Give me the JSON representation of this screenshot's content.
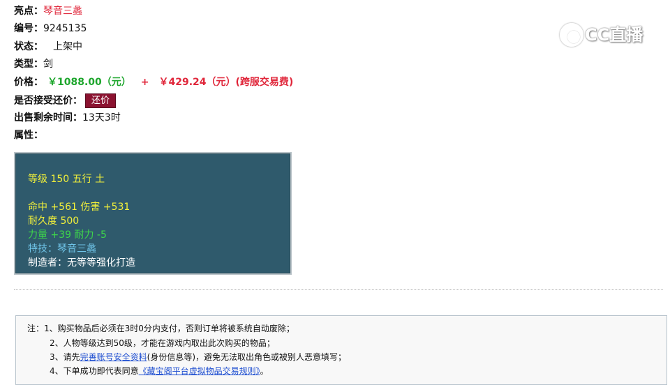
{
  "fields": {
    "highlight": {
      "label": "亮点：",
      "value": "琴音三蠡"
    },
    "number": {
      "label": "编号：",
      "value": "9245135"
    },
    "status": {
      "label": "状态：",
      "value": "上架中"
    },
    "type": {
      "label": "类型：",
      "value": "剑"
    },
    "price": {
      "label": "价格：",
      "amount": "￥1088.00（元）",
      "plus": "+",
      "fee": "￥429.24（元）(跨服交易费)"
    },
    "counter_offer": {
      "label": "是否接受还价：",
      "button": "还价"
    },
    "remaining_time": {
      "label": "出售剩余时间：",
      "value": "13天3时"
    },
    "attributes": {
      "label": "属性："
    }
  },
  "attributes_box": {
    "level_line": "等级 150 五行 土",
    "hit_line": "命中 +561 伤害 +531",
    "durability_line": "耐久度 500",
    "strength_line": "力量 +39 耐力 -5",
    "skill_line": "特技：琴音三蠡",
    "maker_line": "制造者：无等等强化打造"
  },
  "watermark": {
    "text": "CC直播"
  },
  "notes": {
    "prefix": "注：",
    "line1": "1、购买物品后必须在3时0分内支付，否则订单将被系统自动废除；",
    "line2": "2、人物等级达到50级，才能在游戏内取出此次购买的物品；",
    "line3_pre": "3、请先",
    "line3_link": "完善账号安全资料",
    "line3_post": "(身份信息等)，避免无法取出角色或被别人恶意填写；",
    "line4_pre": "4、下单成功即代表同意",
    "line4_link": "《藏宝阁平台虚拟物品交易规则》",
    "line4_post": "。"
  },
  "colors": {
    "accent_red": "#e0263a",
    "price_green": "#1ea62d",
    "button_bg": "#8b1230",
    "attr_box_bg": "#2f5a6c",
    "link": "#1f4fd1"
  }
}
